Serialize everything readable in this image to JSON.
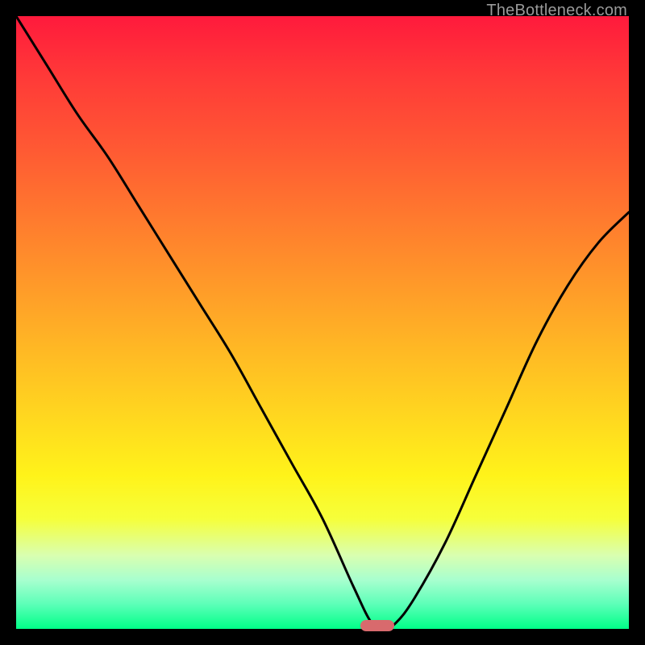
{
  "watermark": "TheBottleneck.com",
  "colors": {
    "curve_stroke": "#000000",
    "marker_fill": "#d86a6d",
    "frame_bg": "#000000"
  },
  "chart_data": {
    "type": "line",
    "title": "",
    "xlabel": "",
    "ylabel": "",
    "xlim": [
      0,
      100
    ],
    "ylim": [
      0,
      100
    ],
    "grid": false,
    "legend": false,
    "annotations": [
      {
        "kind": "pill-marker",
        "x": 59,
        "y": 0
      }
    ],
    "series": [
      {
        "name": "bottleneck-curve",
        "x": [
          0,
          5,
          10,
          15,
          20,
          25,
          30,
          35,
          40,
          45,
          50,
          55,
          58,
          60,
          62,
          65,
          70,
          75,
          80,
          85,
          90,
          95,
          100
        ],
        "y": [
          100,
          92,
          84,
          77,
          69,
          61,
          53,
          45,
          36,
          27,
          18,
          7,
          1,
          0,
          1,
          5,
          14,
          25,
          36,
          47,
          56,
          63,
          68
        ]
      }
    ]
  }
}
